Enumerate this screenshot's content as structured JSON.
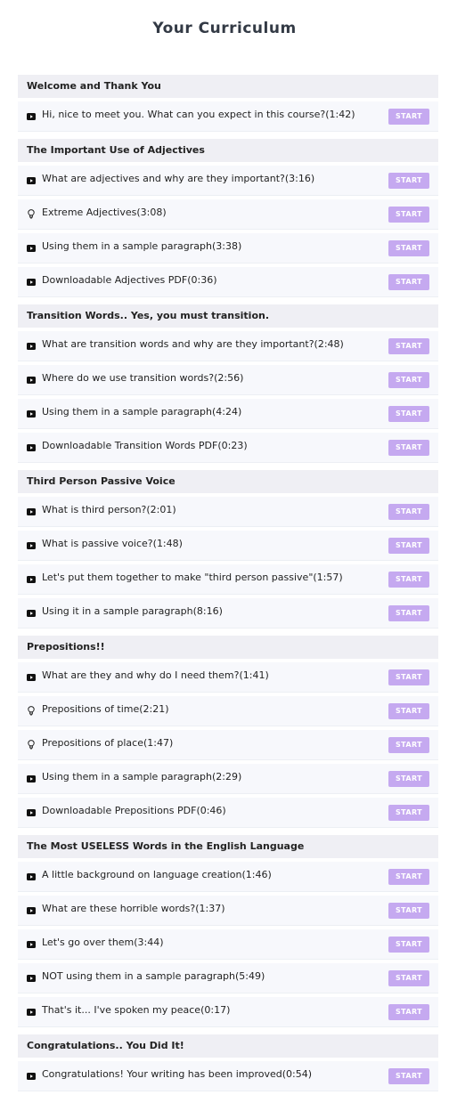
{
  "page": {
    "title": "Your Curriculum"
  },
  "colors": {
    "start_button": "#c5a9f0",
    "section_bg": "#efeff4",
    "lecture_bg": "#f7f8fc"
  },
  "sections": [
    {
      "title": "Welcome and Thank You",
      "lectures": [
        {
          "icon": "video-icon",
          "text": "Hi, nice to meet you. What can you expect in this course?(1:42)",
          "button": "START"
        }
      ]
    },
    {
      "title": "The Important Use of Adjectives",
      "lectures": [
        {
          "icon": "video-icon",
          "text": "What are adjectives and why are they important?(3:16)",
          "button": "START"
        },
        {
          "icon": "lightbulb-icon",
          "text": "Extreme Adjectives(3:08)",
          "button": "START"
        },
        {
          "icon": "video-icon",
          "text": "Using them in a sample paragraph(3:38)",
          "button": "START"
        },
        {
          "icon": "video-icon",
          "text": "Downloadable Adjectives PDF(0:36)",
          "button": "START"
        }
      ]
    },
    {
      "title": "Transition Words.. Yes, you must transition.",
      "lectures": [
        {
          "icon": "video-icon",
          "text": "What are transition words and why are they important?(2:48)",
          "button": "START"
        },
        {
          "icon": "video-icon",
          "text": "Where do we use transition words?(2:56)",
          "button": "START"
        },
        {
          "icon": "video-icon",
          "text": "Using them in a sample paragraph(4:24)",
          "button": "START"
        },
        {
          "icon": "video-icon",
          "text": "Downloadable Transition Words PDF(0:23)",
          "button": "START"
        }
      ]
    },
    {
      "title": "Third Person Passive Voice",
      "lectures": [
        {
          "icon": "video-icon",
          "text": "What is third person?(2:01)",
          "button": "START"
        },
        {
          "icon": "video-icon",
          "text": "What is passive voice?(1:48)",
          "button": "START"
        },
        {
          "icon": "video-icon",
          "text": "Let's put them together to make \"third person passive\"(1:57)",
          "button": "START"
        },
        {
          "icon": "video-icon",
          "text": "Using it in a sample paragraph(8:16)",
          "button": "START"
        }
      ]
    },
    {
      "title": "Prepositions!!",
      "lectures": [
        {
          "icon": "video-icon",
          "text": "What are they and why do I need them?(1:41)",
          "button": "START"
        },
        {
          "icon": "lightbulb-icon",
          "text": "Prepositions of time(2:21)",
          "button": "START"
        },
        {
          "icon": "lightbulb-icon",
          "text": "Prepositions of place(1:47)",
          "button": "START"
        },
        {
          "icon": "video-icon",
          "text": "Using them in a sample paragraph(2:29)",
          "button": "START"
        },
        {
          "icon": "video-icon",
          "text": "Downloadable Prepositions PDF(0:46)",
          "button": "START"
        }
      ]
    },
    {
      "title": "The Most USELESS Words in the English Language",
      "lectures": [
        {
          "icon": "video-icon",
          "text": "A little background on language creation(1:46)",
          "button": "START"
        },
        {
          "icon": "video-icon",
          "text": "What are these horrible words?(1:37)",
          "button": "START"
        },
        {
          "icon": "video-icon",
          "text": "Let's go over them(3:44)",
          "button": "START"
        },
        {
          "icon": "video-icon",
          "text": "NOT using them in a sample paragraph(5:49)",
          "button": "START"
        },
        {
          "icon": "video-icon",
          "text": "That's it... I've spoken my peace(0:17)",
          "button": "START"
        }
      ]
    },
    {
      "title": "Congratulations.. You Did It!",
      "lectures": [
        {
          "icon": "video-icon",
          "text": "Congratulations! Your writing has been improved(0:54)",
          "button": "START"
        }
      ]
    }
  ]
}
